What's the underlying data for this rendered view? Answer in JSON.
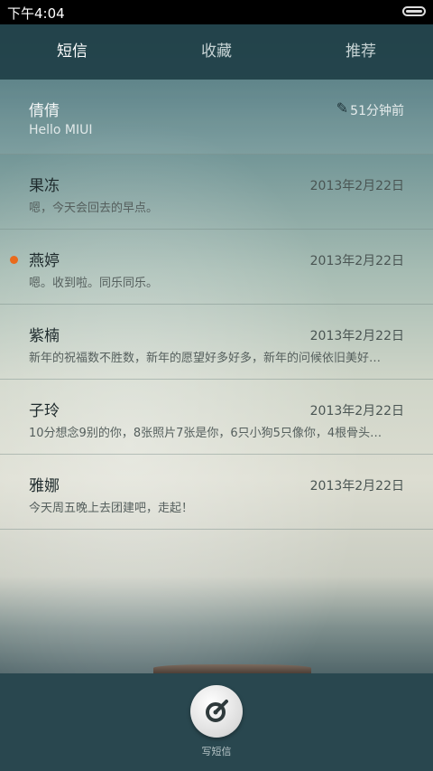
{
  "status_bar": {
    "time": "下午4:04"
  },
  "tabs": [
    {
      "label": "短信",
      "active": true
    },
    {
      "label": "收藏",
      "active": false
    },
    {
      "label": "推荐",
      "active": false
    }
  ],
  "conversations": [
    {
      "name": "倩倩",
      "preview": "Hello MIUI",
      "time": "51分钟前",
      "draft": true,
      "unread": false
    },
    {
      "name": "果冻",
      "preview": "嗯，今天会回去的早点。",
      "time": "2013年2月22日",
      "unread": false
    },
    {
      "name": "燕婷",
      "preview": "嗯。收到啦。同乐同乐。",
      "time": "2013年2月22日",
      "unread": true
    },
    {
      "name": "紫楠",
      "preview": "新年的祝福数不胜数，新年的愿望好多好多，新年的问候依旧美好…",
      "time": "2013年2月22日",
      "unread": false
    },
    {
      "name": "子玲",
      "preview": "10分想念9别的你，8张照片7张是你，6只小狗5只像你，4根骨头…",
      "time": "2013年2月22日",
      "unread": false
    },
    {
      "name": "雅娜",
      "preview": "今天周五晚上去团建吧，走起！",
      "time": "2013年2月22日",
      "unread": false
    }
  ],
  "compose": {
    "label": "写短信",
    "icon": "compose-icon"
  },
  "colors": {
    "unread_dot": "#e96a1c",
    "tab_bar": "#214048",
    "bottom_bar": "#29474f"
  }
}
